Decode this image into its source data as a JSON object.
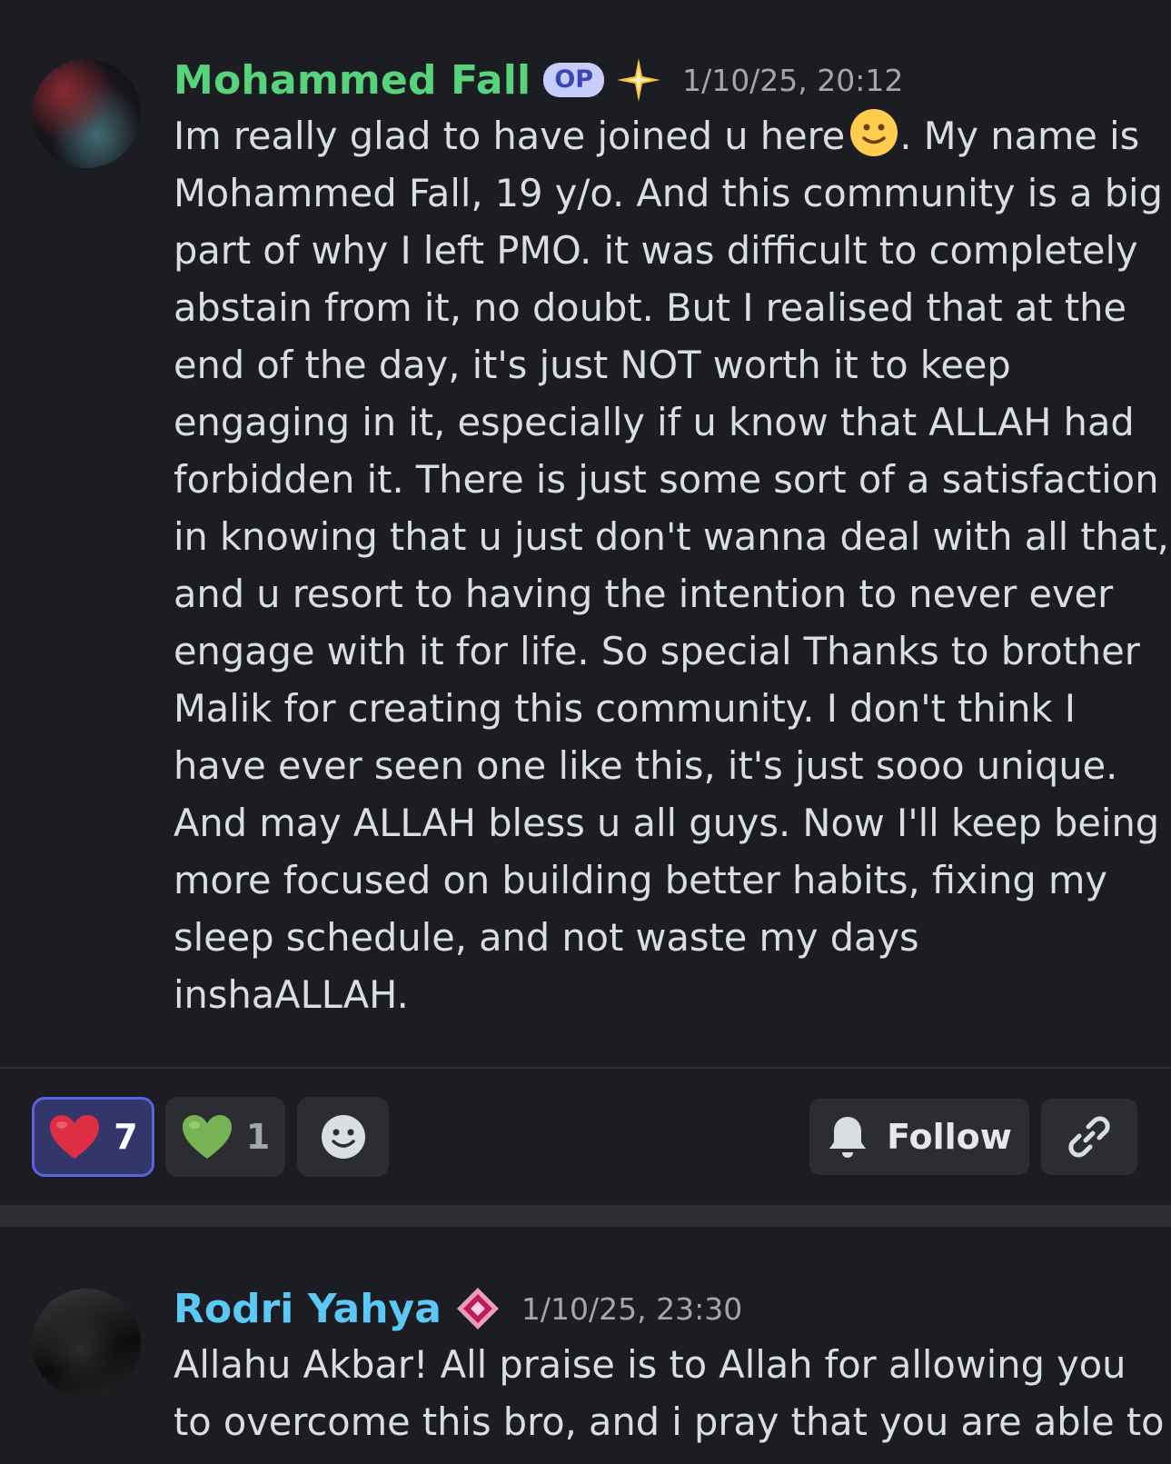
{
  "post": {
    "author": "Mohammed Fall",
    "op_badge": "OP",
    "timestamp": "1/10/25, 20:12",
    "lines": [
      "Im really glad to have joined u here",
      ". My name is",
      "Mohammed Fall, 19 y/o. And this community is a big",
      "part of why I left PMO. it was difficult to completely",
      "abstain from it, no doubt. But I realised that at the",
      "end of the day, it's just NOT worth it to keep",
      "engaging in it, especially if u know that ALLAH had",
      "forbidden it. There is just some sort of a satisfaction",
      "in knowing that u just don't wanna deal with all that,",
      "and u resort to having the intention to never ever",
      "engage with it for life. So special Thanks to brother",
      "Malik for creating this community. I don't think I",
      "have ever seen one like this, it's just sooo unique.",
      "And may ALLAH bless u all guys. Now I'll keep being",
      "more focused on building better habits, fixing my",
      "sleep schedule, and not waste my days",
      "inshaALLAH."
    ]
  },
  "reactions": [
    {
      "emoji": "red-heart",
      "count": "7",
      "selected": true
    },
    {
      "emoji": "green-heart",
      "count": "1",
      "selected": false
    }
  ],
  "actions": {
    "follow_label": "Follow"
  },
  "reply": {
    "author": "Rodri Yahya",
    "timestamp": "1/10/25, 23:30",
    "lines": [
      "Allahu Akbar! All praise is to Allah for allowing you",
      "to overcome this bro, and i pray that you are able to"
    ]
  },
  "colors": {
    "background": "#1c1d22",
    "op_name": "#57d47b",
    "reply_name": "#5bc8f5",
    "selected_reaction": "#5a63dd"
  }
}
